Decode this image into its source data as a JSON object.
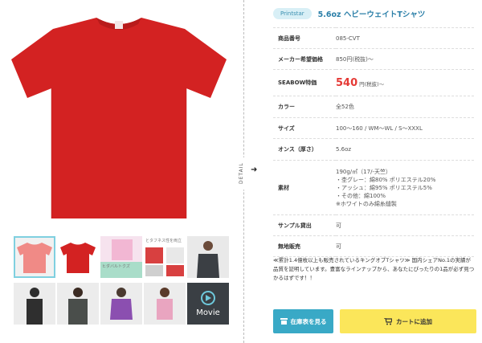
{
  "product": {
    "brand": "Printstar",
    "title": "5.6oz ヘビーウェイトTシャツ"
  },
  "colors": {
    "shirt_red": "#d32222",
    "accent_blue": "#39a9c6",
    "cart_yellow": "#fbe65a",
    "price_red": "#e53935"
  },
  "specs": [
    {
      "key": "商品番号",
      "value": "085-CVT"
    },
    {
      "key": "メーカー希望価格",
      "value": "850円(税抜)〜"
    },
    {
      "key": "SEABOW特価",
      "price": "540",
      "suffix": "円(税抜)〜"
    },
    {
      "key": "カラー",
      "value": "全52色"
    },
    {
      "key": "サイズ",
      "value": "100〜160 / WM〜WL / S〜XXXL"
    },
    {
      "key": "オンス（厚さ）",
      "value": "5.6oz"
    },
    {
      "key": "素材",
      "lines": [
        "190g/㎡（17/-天竺）",
        "・杢グレー：綿80% ポリエステル20%",
        "・アッシュ：綿95% ポリエステル5%",
        "・その他：綿100%",
        "※ホワイトのみ綿糸縫製"
      ]
    },
    {
      "key": "サンプル貸出",
      "value": "可"
    },
    {
      "key": "無地販売",
      "value": "可"
    }
  ],
  "description": "≪累計1.4億枚以上も販売されているキングオブTシャツ≫ 国内シェアNo.1の実績が品質を証明しています。豊富なラインナップから、あなたにぴったりの1品が必ず見つかるはずです！！",
  "detail_label": "DETAIL",
  "thumbs_text": {
    "caption1": "とタフネス性を両立",
    "caption2": "ヒダバルトクズ",
    "movie": "Movie"
  },
  "buttons": {
    "stock": "在庫表を見る",
    "cart": "カートに追加"
  }
}
